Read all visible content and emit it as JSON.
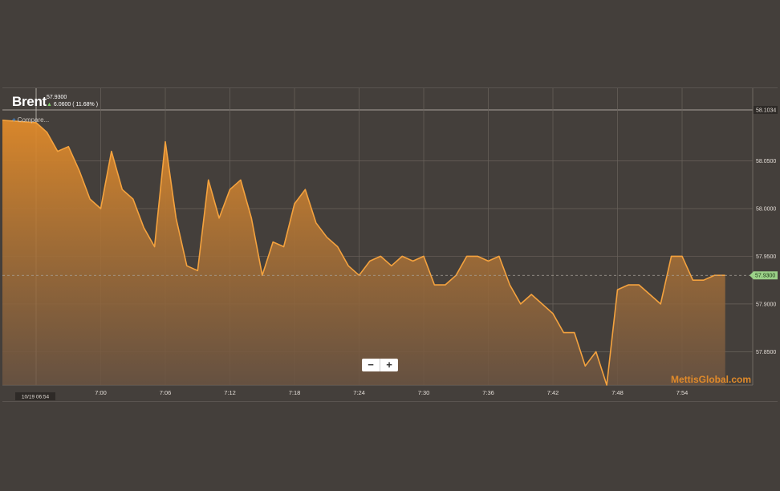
{
  "symbol": {
    "name": "Brent",
    "price": "57.9300",
    "change": "6.0600 ( 11.68% )"
  },
  "compare_label": "Compare...",
  "zoom": {
    "minus": "−",
    "plus": "+"
  },
  "watermark": "MettisGlobal.com",
  "colors": {
    "line": "#f4a23e",
    "fill_top": "#e08a2a",
    "fill_bottom": "#6b5442",
    "grid": "#6a635d",
    "background": "#443f3b",
    "last_price_badge": "#9bd188"
  },
  "chart_data": {
    "type": "area",
    "x_labels": [
      "7:00",
      "7:06",
      "7:12",
      "7:18",
      "7:24",
      "7:30",
      "7:36",
      "7:42",
      "7:48",
      "7:54"
    ],
    "x_start_label": "10/19 06:54",
    "y_ticks": [
      "57.8500",
      "57.9000",
      "57.9500",
      "58.0000",
      "58.0500"
    ],
    "ylim": [
      57.815,
      58.1034
    ],
    "high_label": "58.1034",
    "last_label": "57.9300",
    "last_value": 57.93,
    "series": [
      {
        "x": [
          "06:54",
          "06:55",
          "06:56",
          "06:57",
          "06:58",
          "06:59",
          "07:00",
          "07:01",
          "07:02",
          "07:03",
          "07:04",
          "07:05",
          "07:06",
          "07:07",
          "07:08",
          "07:09",
          "07:10",
          "07:11",
          "07:12",
          "07:13",
          "07:14",
          "07:15",
          "07:16",
          "07:17",
          "07:18",
          "07:19",
          "07:20",
          "07:21",
          "07:22",
          "07:23",
          "07:24",
          "07:25",
          "07:26",
          "07:27",
          "07:28",
          "07:29",
          "07:30",
          "07:31",
          "07:32",
          "07:33",
          "07:34",
          "07:35",
          "07:36",
          "07:37",
          "07:38",
          "07:39",
          "07:40",
          "07:41",
          "07:42",
          "07:43",
          "07:44",
          "07:45",
          "07:46",
          "07:47",
          "07:48",
          "07:49",
          "07:50",
          "07:51",
          "07:52",
          "07:53",
          "07:54",
          "07:55",
          "07:56",
          "07:57",
          "07:58"
        ],
        "values": [
          58.09,
          58.08,
          58.06,
          58.065,
          58.04,
          58.01,
          58.0,
          58.06,
          58.02,
          58.01,
          57.98,
          57.96,
          58.07,
          57.99,
          57.94,
          57.935,
          58.03,
          57.99,
          58.02,
          58.03,
          57.99,
          57.93,
          57.965,
          57.96,
          58.005,
          58.02,
          57.985,
          57.97,
          57.96,
          57.94,
          57.93,
          57.945,
          57.95,
          57.94,
          57.95,
          57.945,
          57.95,
          57.92,
          57.92,
          57.93,
          57.95,
          57.95,
          57.945,
          57.95,
          57.92,
          57.9,
          57.91,
          57.9,
          57.89,
          57.87,
          57.87,
          57.835,
          57.85,
          57.815,
          57.915,
          57.92,
          57.92,
          57.91,
          57.9,
          57.95,
          57.95,
          57.925,
          57.925,
          57.93,
          57.93
        ]
      }
    ]
  }
}
